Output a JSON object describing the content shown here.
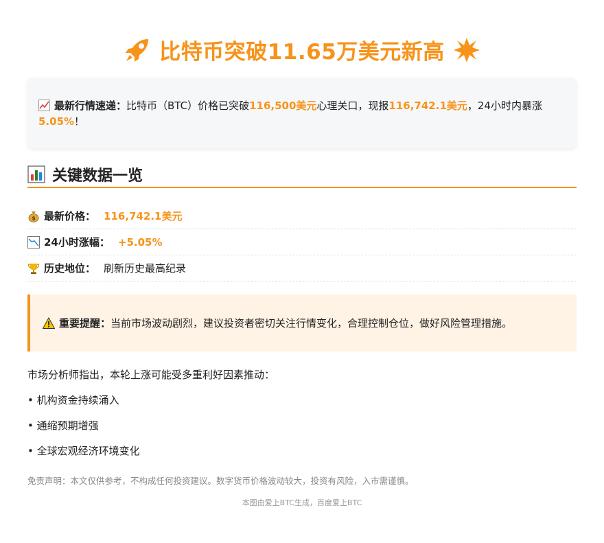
{
  "header": {
    "title": "比特币突破11.65万美元新高",
    "left_icon": "rocket-icon",
    "right_icon": "starburst-icon",
    "accent_color": "#f7931a"
  },
  "news": {
    "icon": "chart-increasing-icon",
    "label": "最新行情速递：",
    "text1": "比特币（BTC）价格已突破",
    "highlight1": "116,500美元",
    "text2": "心理关口，现报",
    "highlight2": "116,742.1美元",
    "text3": "，24小时内暴涨",
    "highlight3": "5.05%",
    "text4": "！"
  },
  "section": {
    "icon": "bar-chart-icon",
    "title": "关键数据一览"
  },
  "key_data": [
    {
      "icon": "money-bag-icon",
      "label": "最新价格：",
      "value": "116,742.1美元"
    },
    {
      "icon": "chart-icon",
      "label": "24小时涨幅：",
      "value": "+5.05%"
    },
    {
      "icon": "trophy-icon",
      "label": "历史地位：",
      "value": "刷新历史最高纪录"
    }
  ],
  "warning": {
    "icon": "warning-icon",
    "label": "重要提醒：",
    "text": "当前市场波动剧烈，建议投资者密切关注行情变化，合理控制仓位，做好风险管理措施。"
  },
  "analysis": {
    "intro": "市场分析师指出，本轮上涨可能受多重利好因素推动：",
    "bullets": [
      "• 机构资金持续涌入",
      "• 通缩预期增强",
      "• 全球宏观经济环境变化"
    ]
  },
  "disclaimer": "免责声明：本文仅供参考，不构成任何投资建议。数字货币价格波动较大，投资有风险，入市需谨慎。",
  "footer": "本图由爱上BTC生成，百度爱上BTC"
}
